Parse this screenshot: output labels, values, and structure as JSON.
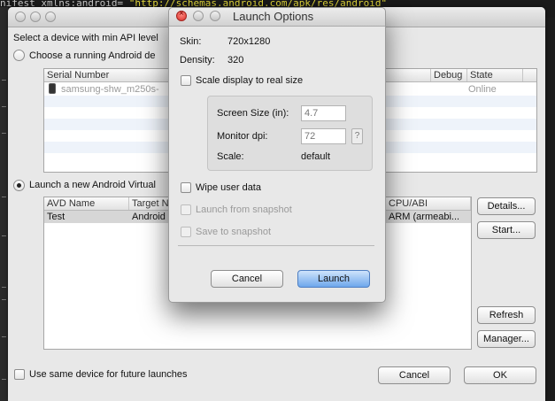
{
  "editor": {
    "code_attr": "nifest xmlns:android=",
    "code_value": "\"http://schemas.android.com/apk/res/android\""
  },
  "device_chooser": {
    "min_api_text": "Select a device with min API level",
    "choose_running_label": "Choose a running Android de",
    "running_columns": [
      "Serial Number",
      "",
      "Debug",
      "State"
    ],
    "running_devices": [
      {
        "serial": "samsung-shw_m250s-",
        "debug": "",
        "state": "Online"
      }
    ],
    "launch_new_label": "Launch a new Android Virtual",
    "avd_columns": [
      "AVD Name",
      "Target N",
      "CPU/ABI"
    ],
    "avds": [
      {
        "name": "Test",
        "target": "Android",
        "cpu": "ARM (armeabi..."
      }
    ],
    "buttons": {
      "details": "Details...",
      "start": "Start...",
      "refresh": "Refresh",
      "manager": "Manager..."
    },
    "same_device_label": "Use same device for future launches",
    "cancel": "Cancel",
    "ok": "OK"
  },
  "launch_options": {
    "title": "Launch Options",
    "skin_label": "Skin:",
    "skin_value": "720x1280",
    "density_label": "Density:",
    "density_value": "320",
    "scale_real_label": "Scale display to real size",
    "screen_size_label": "Screen Size (in):",
    "screen_size_value": "4.7",
    "monitor_dpi_label": "Monitor dpi:",
    "monitor_dpi_value": "72",
    "help_button": "?",
    "scale_label": "Scale:",
    "scale_value": "default",
    "wipe_label": "Wipe user data",
    "launch_snapshot_label": "Launch from snapshot",
    "save_snapshot_label": "Save to snapshot",
    "cancel": "Cancel",
    "launch": "Launch"
  },
  "colors": {
    "selection": "#d6d6d6",
    "stripe": "#eef3fa",
    "default_button": "#6ea7ec"
  }
}
